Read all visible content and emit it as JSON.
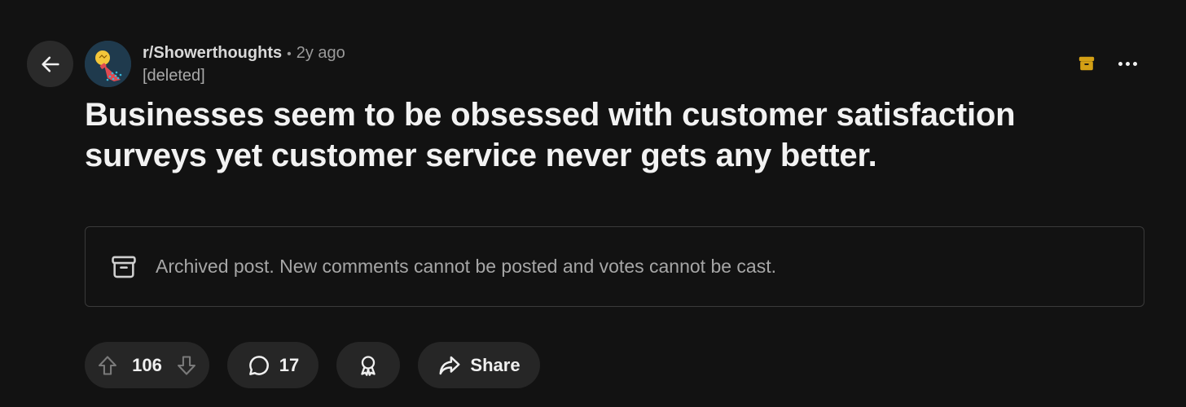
{
  "post": {
    "subreddit": "r/Showerthoughts",
    "separator": "•",
    "time_ago": "2y ago",
    "author": "[deleted]",
    "title": "Businesses seem to be obsessed with customer satisfaction surveys yet customer service never gets any better."
  },
  "notice": {
    "text": "Archived post. New comments cannot be posted and votes cannot be cast."
  },
  "actions": {
    "vote_count": "106",
    "comment_count": "17",
    "share_label": "Share"
  },
  "icons": {
    "back": "arrow-left-icon",
    "avatar": "showerhead-lightbulb-icon",
    "archive_badge": "archive-box-icon",
    "more": "ellipsis-horizontal-icon",
    "notice": "archive-box-icon",
    "upvote": "arrow-up-icon",
    "downvote": "arrow-down-icon",
    "comment": "speech-bubble-icon",
    "award": "award-ribbon-icon",
    "share": "share-arrow-icon"
  },
  "colors": {
    "background": "#121212",
    "pill": "#262626",
    "archive_badge": "#d4a015",
    "text_primary": "#f2f2f2",
    "text_muted": "#9a9a9a"
  }
}
